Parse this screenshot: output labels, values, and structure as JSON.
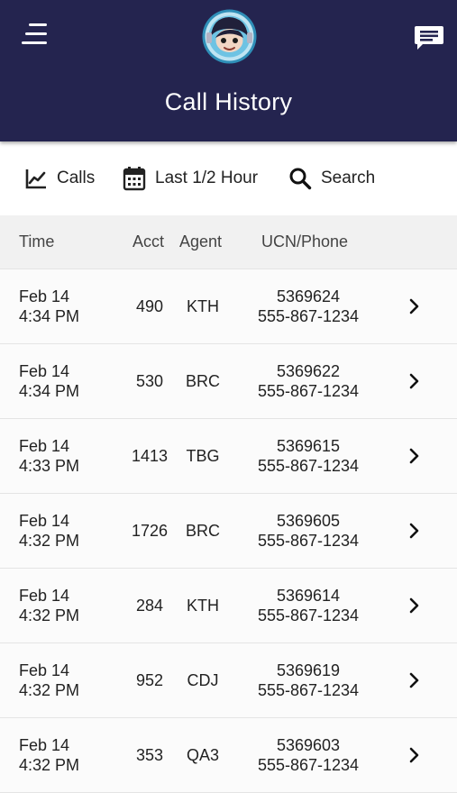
{
  "header": {
    "title": "Call History",
    "menu_icon": "hamburger-menu-icon",
    "avatar": "astronaut-avatar-logo",
    "chat_icon": "chat-message-icon",
    "background_color": "#24244f"
  },
  "toolbar": {
    "calls_label": "Calls",
    "calls_icon": "line-chart-icon",
    "range_label": "Last 1/2 Hour",
    "range_icon": "calendar-icon",
    "search_label": "Search",
    "search_icon": "search-icon"
  },
  "table": {
    "columns": {
      "time": "Time",
      "acct": "Acct",
      "agent": "Agent",
      "ucn": "UCN/Phone"
    },
    "rows": [
      {
        "date": "Feb 14",
        "time": "4:34 PM",
        "acct": "490",
        "agent": "KTH",
        "ucn": "5369624",
        "phone": "555-867-1234"
      },
      {
        "date": "Feb 14",
        "time": "4:34 PM",
        "acct": "530",
        "agent": "BRC",
        "ucn": "5369622",
        "phone": "555-867-1234"
      },
      {
        "date": "Feb 14",
        "time": "4:33 PM",
        "acct": "1413",
        "agent": "TBG",
        "ucn": "5369615",
        "phone": "555-867-1234"
      },
      {
        "date": "Feb 14",
        "time": "4:32 PM",
        "acct": "1726",
        "agent": "BRC",
        "ucn": "5369605",
        "phone": "555-867-1234"
      },
      {
        "date": "Feb 14",
        "time": "4:32 PM",
        "acct": "284",
        "agent": "KTH",
        "ucn": "5369614",
        "phone": "555-867-1234"
      },
      {
        "date": "Feb 14",
        "time": "4:32 PM",
        "acct": "952",
        "agent": "CDJ",
        "ucn": "5369619",
        "phone": "555-867-1234"
      },
      {
        "date": "Feb 14",
        "time": "4:32 PM",
        "acct": "353",
        "agent": "QA3",
        "ucn": "5369603",
        "phone": "555-867-1234"
      }
    ]
  }
}
